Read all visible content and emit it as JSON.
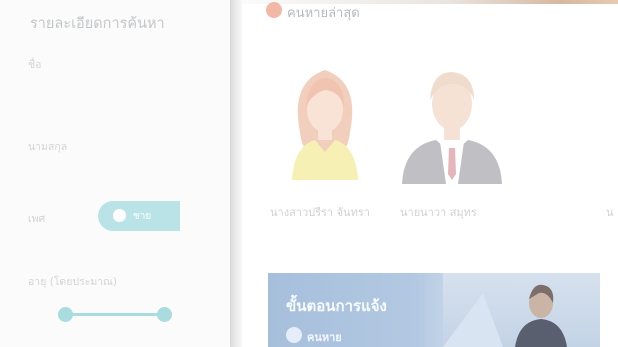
{
  "search_panel": {
    "title": "รายละเอียดการค้นหา",
    "name_label": "ชื่อ",
    "surname_label": "นามสกุล",
    "gender_label": "เพศ",
    "gender_selected": "ชาย",
    "age_label": "อายุ (โดยประมาณ)",
    "age_range": [
      0,
      1
    ]
  },
  "latest": {
    "title": "คนหายล่าสุด",
    "people": [
      {
        "name": "นางสาวปรีรา จันทรา"
      },
      {
        "name": "นายนาวา สมุทร"
      },
      {
        "name": "น"
      }
    ]
  },
  "banner": {
    "title": "ขั้นตอนการแจ้ง",
    "cta": "คนหาย"
  },
  "colors": {
    "accent": "#b9e3e6",
    "latest_icon": "#f3b8a5",
    "banner": "#a6bfdc"
  }
}
